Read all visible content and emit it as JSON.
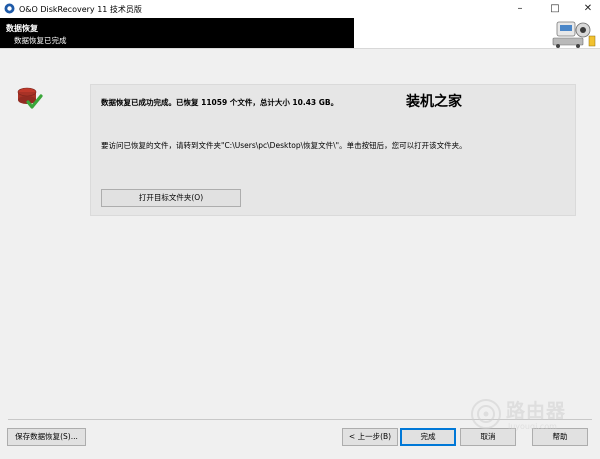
{
  "window": {
    "title": "O&O DiskRecovery 11 技术员版",
    "minimize_glyph": "–",
    "maximize_glyph": "□",
    "close_glyph": "✕"
  },
  "header": {
    "title": "数据恢复",
    "subtitle": "数据恢复已完成"
  },
  "main": {
    "message_summary": "数据恢复已成功完成。已恢复 11059 个文件，总计大小 10.43 GB。",
    "watermark_text": "装机之家",
    "message_instruction": "要访问已恢复的文件，请转到文件夹\"C:\\Users\\pc\\Desktop\\恢复文件\\\"。单击按钮后，您可以打开该文件夹。",
    "open_folder_button": "打开目标文件夹(O)"
  },
  "footer": {
    "save_button": "保存数据恢复(S)...",
    "back_button": "< 上一步(B)",
    "finish_button": "完成",
    "cancel_button": "取消",
    "help_button": "帮助"
  },
  "corner_watermark": {
    "text": "路由器",
    "subtext": "luyouqi.com"
  },
  "colors": {
    "header_bg": "#000000",
    "accent": "#0078d7",
    "success_check": "#3aa63a"
  }
}
